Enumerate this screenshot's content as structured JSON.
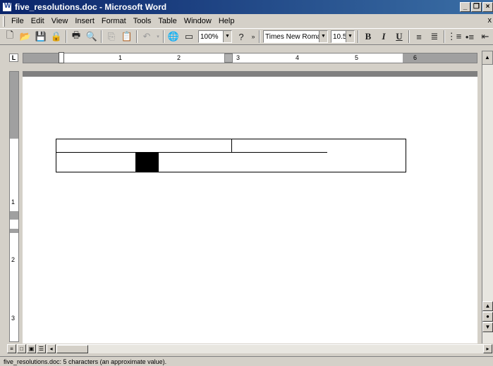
{
  "window": {
    "title": "five_resolutions.doc - Microsoft Word"
  },
  "menu": [
    "File",
    "Edit",
    "View",
    "Insert",
    "Format",
    "Tools",
    "Table",
    "Window",
    "Help"
  ],
  "toolbar": {
    "zoom": "100%",
    "font_name": "Times New Roman",
    "font_size": "10.5",
    "bold_label": "B",
    "italic_label": "I",
    "underline_label": "U"
  },
  "ruler": {
    "marks": [
      "1",
      "2",
      "3",
      "4",
      "5",
      "6"
    ]
  },
  "status": {
    "text": "five_resolutions.doc: 5 characters (an approximate value)."
  }
}
